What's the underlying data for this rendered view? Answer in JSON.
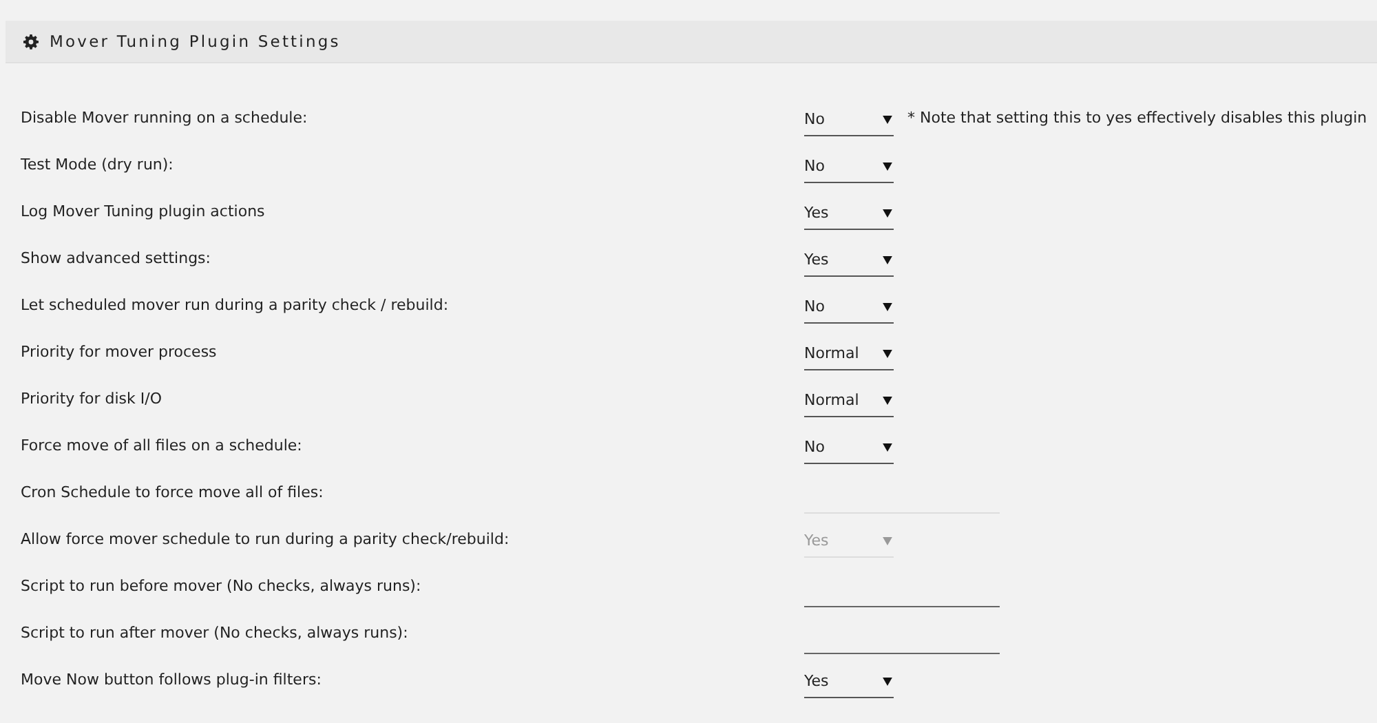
{
  "header": {
    "title": "Mover Tuning Plugin Settings"
  },
  "settings": [
    {
      "label": "Disable Mover running on a schedule:",
      "kind": "select",
      "value": "No",
      "disabled": false,
      "note": "* Note that setting this to yes effectively disables this plugin"
    },
    {
      "label": "Test Mode (dry run):",
      "kind": "select",
      "value": "No",
      "disabled": false
    },
    {
      "label": "Log Mover Tuning plugin actions",
      "kind": "select",
      "value": "Yes",
      "disabled": false
    },
    {
      "label": "Show advanced settings:",
      "kind": "select",
      "value": "Yes",
      "disabled": false
    },
    {
      "label": "Let scheduled mover run during a parity check / rebuild:",
      "kind": "select",
      "value": "No",
      "disabled": false
    },
    {
      "label": "Priority for mover process",
      "kind": "select",
      "value": "Normal",
      "disabled": false
    },
    {
      "label": "Priority for disk I/O",
      "kind": "select",
      "value": "Normal",
      "disabled": false
    },
    {
      "label": "Force move of all files on a schedule:",
      "kind": "select",
      "value": "No",
      "disabled": false
    },
    {
      "label": "Cron Schedule to force move all of files:",
      "kind": "text",
      "disabled": true
    },
    {
      "label": "Allow force mover schedule to run during a parity check/rebuild:",
      "kind": "select",
      "value": "Yes",
      "disabled": true
    },
    {
      "label": "Script to run before mover (No checks, always runs):",
      "kind": "text",
      "disabled": false
    },
    {
      "label": "Script to run after mover (No checks, always runs):",
      "kind": "text",
      "disabled": false
    },
    {
      "label": "Move Now button follows plug-in filters:",
      "kind": "select",
      "value": "Yes",
      "disabled": false
    }
  ]
}
